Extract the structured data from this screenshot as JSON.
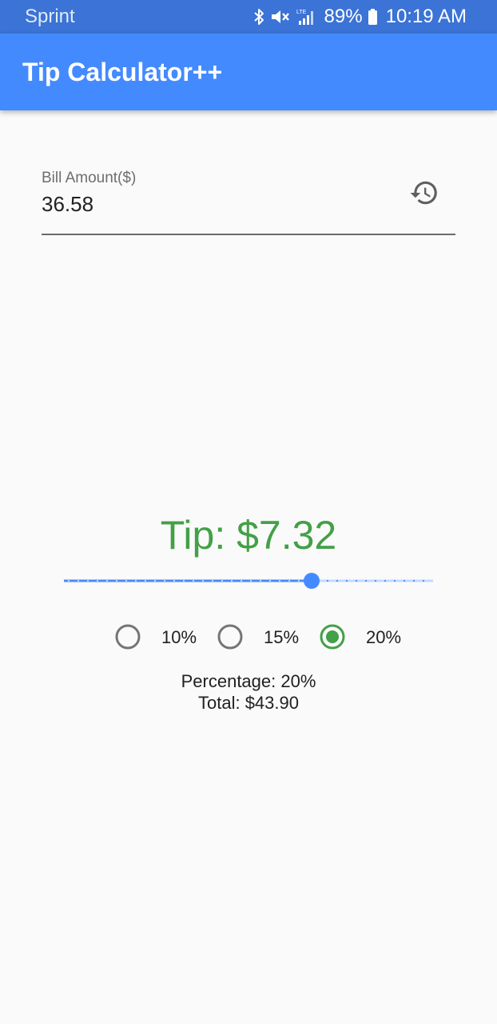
{
  "status_bar": {
    "carrier": "Sprint",
    "battery": "89%",
    "time": "10:19 AM",
    "icons": [
      "bluetooth-icon",
      "mute-icon",
      "lte-signal-icon",
      "battery-icon"
    ]
  },
  "app_bar": {
    "title": "Tip Calculator++",
    "color": "#448aff"
  },
  "bill": {
    "label": "Bill Amount($)",
    "value": "36.58",
    "history_icon": "history-icon"
  },
  "tip": {
    "text": "Tip: $7.32",
    "color": "#43a047"
  },
  "slider": {
    "value_fraction": 0.67,
    "color": "#448aff"
  },
  "percent_options": [
    {
      "label": "10%",
      "selected": false
    },
    {
      "label": "15%",
      "selected": false
    },
    {
      "label": "20%",
      "selected": true
    }
  ],
  "summary": {
    "percentage": "Percentage: 20%",
    "total": "Total: $43.90"
  }
}
